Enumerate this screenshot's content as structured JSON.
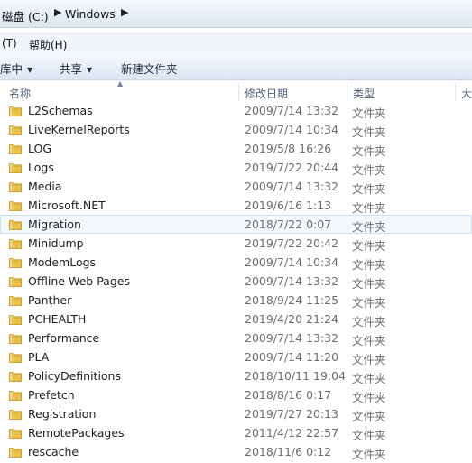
{
  "address": {
    "crumbs": [
      "磁盘 (C:)",
      "Windows"
    ],
    "arrow": "▶"
  },
  "menubar": {
    "items": [
      "(T)",
      "帮助(H)"
    ]
  },
  "toolbar": {
    "library_label": "库中",
    "share_label": "共享",
    "new_folder_label": "新建文件夹",
    "caret": "▼"
  },
  "columns": {
    "name": "名称",
    "date": "修改日期",
    "type": "类型",
    "size": "大"
  },
  "files": [
    {
      "name": "L2Schemas",
      "date": "2009/7/14 13:32",
      "type": "文件夹"
    },
    {
      "name": "LiveKernelReports",
      "date": "2009/7/14 10:34",
      "type": "文件夹"
    },
    {
      "name": "LOG",
      "date": "2019/5/8 16:26",
      "type": "文件夹"
    },
    {
      "name": "Logs",
      "date": "2019/7/22 20:44",
      "type": "文件夹"
    },
    {
      "name": "Media",
      "date": "2009/7/14 13:32",
      "type": "文件夹"
    },
    {
      "name": "Microsoft.NET",
      "date": "2019/6/16 1:13",
      "type": "文件夹"
    },
    {
      "name": "Migration",
      "date": "2018/7/22 0:07",
      "type": "文件夹",
      "selected": true
    },
    {
      "name": "Minidump",
      "date": "2019/7/22 20:42",
      "type": "文件夹"
    },
    {
      "name": "ModemLogs",
      "date": "2009/7/14 10:34",
      "type": "文件夹"
    },
    {
      "name": "Offline Web Pages",
      "date": "2009/7/14 13:32",
      "type": "文件夹"
    },
    {
      "name": "Panther",
      "date": "2018/9/24 11:25",
      "type": "文件夹"
    },
    {
      "name": "PCHEALTH",
      "date": "2019/4/20 21:24",
      "type": "文件夹"
    },
    {
      "name": "Performance",
      "date": "2009/7/14 13:32",
      "type": "文件夹"
    },
    {
      "name": "PLA",
      "date": "2009/7/14 11:20",
      "type": "文件夹"
    },
    {
      "name": "PolicyDefinitions",
      "date": "2018/10/11 19:04",
      "type": "文件夹"
    },
    {
      "name": "Prefetch",
      "date": "2018/8/16 0:17",
      "type": "文件夹"
    },
    {
      "name": "Registration",
      "date": "2019/7/27 20:13",
      "type": "文件夹"
    },
    {
      "name": "RemotePackages",
      "date": "2011/4/12 22:57",
      "type": "文件夹"
    },
    {
      "name": "rescache",
      "date": "2018/11/6 0:12",
      "type": "文件夹"
    }
  ],
  "colors": {
    "folder": "#e9c04a",
    "selection_border": "#cfe0f3"
  }
}
